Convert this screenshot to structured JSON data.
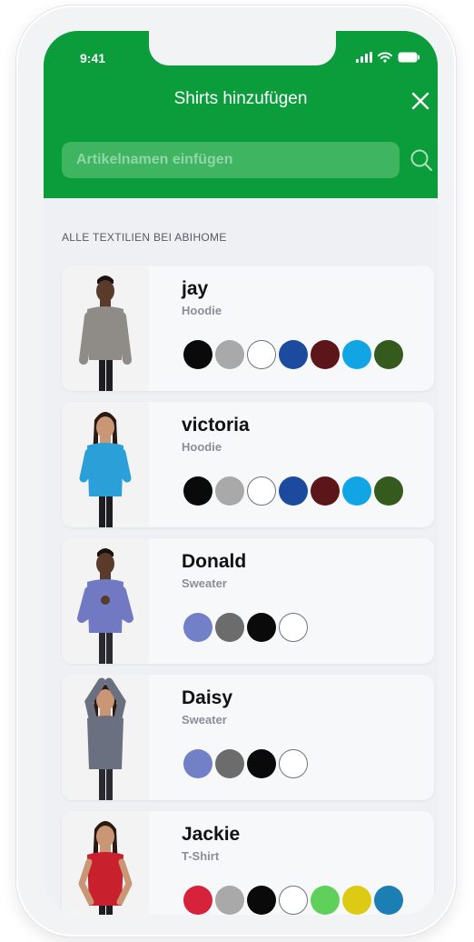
{
  "status_bar": {
    "time": "9:41"
  },
  "header": {
    "title": "Shirts hinzufügen",
    "close_icon": "close-icon"
  },
  "search": {
    "placeholder": "Artikelnamen einfügen",
    "value": "",
    "icon": "search-icon"
  },
  "section_label": "ALLE TEXTILIEN BEI ABIHOME",
  "colors": {
    "header_green": "#0b9c3c",
    "search_green": "#3fb461",
    "background": "#eef0f4"
  },
  "products": [
    {
      "name": "jay",
      "type": "Hoodie",
      "image": {
        "skin": "#5a3a2a",
        "top": "#8f8b86",
        "bottom": "#1e1e22",
        "pose": "arms-down"
      },
      "swatches": [
        "#0a0a0a",
        "#a9a9a9",
        "#ffffff",
        "#1b4a9e",
        "#5c1518",
        "#12a5e6",
        "#345a1d"
      ]
    },
    {
      "name": "victoria",
      "type": "Hoodie",
      "image": {
        "skin": "#c99776",
        "top": "#2a9fd8",
        "bottom": "#1e1e22",
        "pose": "hands-hood"
      },
      "swatches": [
        "#0a0a0a",
        "#a9a9a9",
        "#ffffff",
        "#1b4a9e",
        "#5c1518",
        "#12a5e6",
        "#345a1d"
      ]
    },
    {
      "name": "Donald",
      "type": "Sweater",
      "image": {
        "skin": "#5a3a2a",
        "top": "#7079c2",
        "bottom": "#2a2a30",
        "pose": "hands-together"
      },
      "swatches": [
        "#7280c8",
        "#6c6c6c",
        "#0a0a0a",
        "#ffffff"
      ]
    },
    {
      "name": "Daisy",
      "type": "Sweater",
      "image": {
        "skin": "#c99776",
        "top": "#6b7080",
        "bottom": "#2a2a30",
        "pose": "arms-up"
      },
      "swatches": [
        "#7280c8",
        "#6c6c6c",
        "#0a0a0a",
        "#ffffff"
      ]
    },
    {
      "name": "Jackie",
      "type": "T-Shirt",
      "image": {
        "skin": "#c99776",
        "top": "#c8202d",
        "bottom": "#1e1e22",
        "pose": "hands-hips"
      },
      "swatches": [
        "#d6223a",
        "#a9a9a9",
        "#0a0a0a",
        "#ffffff",
        "#5fd15a",
        "#dccb12",
        "#1b7fb4"
      ]
    }
  ]
}
